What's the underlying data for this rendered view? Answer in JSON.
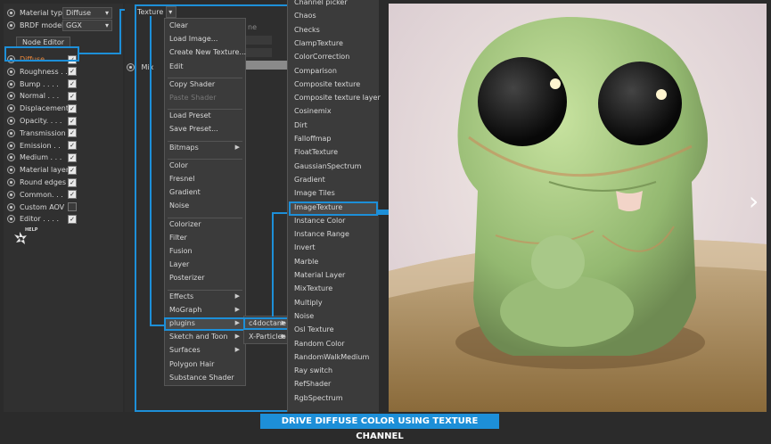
{
  "left_panel": {
    "material_type_label": "Material type",
    "material_type_value": "Diffuse",
    "brdf_label": "BRDF model",
    "brdf_value": "GGX",
    "node_editor": "Node Editor",
    "channels": [
      {
        "label": "Diffuse . . .",
        "checked": true,
        "active": true
      },
      {
        "label": "Roughness . .",
        "checked": true
      },
      {
        "label": "Bump . . . .",
        "checked": true
      },
      {
        "label": "Normal . . .",
        "checked": true
      },
      {
        "label": "Displacement",
        "checked": true
      },
      {
        "label": "Opacity. . . .",
        "checked": true
      },
      {
        "label": "Transmission",
        "checked": true
      },
      {
        "label": "Emission . .",
        "checked": true
      },
      {
        "label": "Medium . . .",
        "checked": true
      },
      {
        "label": "Material layer",
        "checked": true
      },
      {
        "label": "Round edges",
        "checked": true
      },
      {
        "label": "Common. . .",
        "checked": true
      },
      {
        "label": "Custom AOV",
        "checked": false
      },
      {
        "label": "Editor . . . .",
        "checked": true
      }
    ],
    "help_label": "HELP"
  },
  "middle": {
    "texture_label": "Texture",
    "mix_label": "Mix",
    "partial_text": "ne"
  },
  "context_menu": {
    "items": [
      {
        "label": "Clear"
      },
      {
        "label": "Load Image..."
      },
      {
        "label": "Create New Texture..."
      },
      {
        "label": "Edit"
      },
      {
        "sep": true
      },
      {
        "label": "Copy Shader"
      },
      {
        "label": "Paste Shader",
        "disabled": true
      },
      {
        "sep": true
      },
      {
        "label": "Load Preset"
      },
      {
        "label": "Save Preset..."
      },
      {
        "sep": true
      },
      {
        "label": "Bitmaps",
        "sub": true
      },
      {
        "sep": true
      },
      {
        "label": "Color"
      },
      {
        "label": "Fresnel"
      },
      {
        "label": "Gradient"
      },
      {
        "label": "Noise"
      },
      {
        "sep": true
      },
      {
        "label": "Colorizer"
      },
      {
        "label": "Filter"
      },
      {
        "label": "Fusion"
      },
      {
        "label": "Layer"
      },
      {
        "label": "Posterizer"
      },
      {
        "sep": true
      },
      {
        "label": "Effects",
        "sub": true
      },
      {
        "label": "MoGraph",
        "sub": true
      },
      {
        "label": "plugins",
        "sub": true,
        "highlight": true
      },
      {
        "label": "Sketch and Toon",
        "sub": true
      },
      {
        "label": "Surfaces",
        "sub": true
      },
      {
        "label": "Polygon Hair"
      },
      {
        "label": "Substance Shader"
      }
    ]
  },
  "plugins_submenu": {
    "items": [
      {
        "label": "c4doctane",
        "sub": true,
        "highlight": true
      },
      {
        "label": "X-Particles",
        "sub": true
      }
    ]
  },
  "octane_list": {
    "items": [
      "Channel picker",
      "Chaos",
      "Checks",
      "ClampTexture",
      "ColorCorrection",
      "Comparison",
      "Composite texture",
      "Composite texture layer",
      "Cosinemix",
      "Dirt",
      "Falloffmap",
      "FloatTexture",
      "GaussianSpectrum",
      "Gradient",
      "Image Tiles",
      "ImageTexture",
      "Instance Color",
      "Instance Range",
      "Invert",
      "Marble",
      "Material Layer",
      "MixTexture",
      "Multiply",
      "Noise",
      "Osl Texture",
      "Random Color",
      "RandomWalkMedium",
      "Ray switch",
      "RefShader",
      "RgbSpectrum"
    ],
    "highlight_index": 15
  },
  "caption": "DRIVE DIFFUSE COLOR USING TEXTURE CHANNEL",
  "colors": {
    "accent": "#1d8fd8",
    "panel": "#303030",
    "menu": "#3b3b3b"
  }
}
